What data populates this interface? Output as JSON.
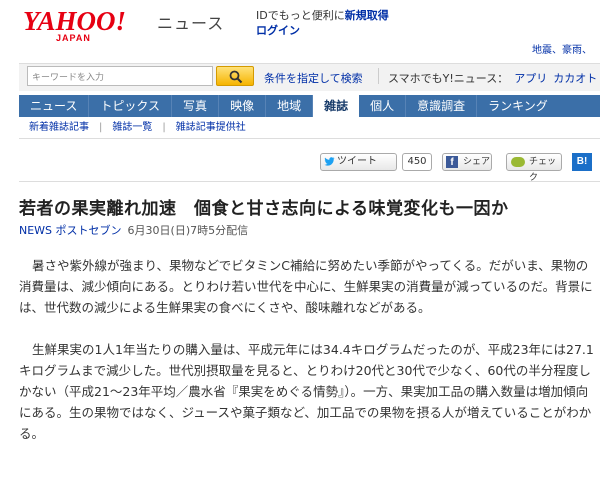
{
  "header": {
    "logo_text": "YAHOO!",
    "logo_sub": "JAPAN",
    "service_name": "ニュース",
    "promo_text": "IDでもっと便利に",
    "promo_link": "新規取得",
    "login_link": "ログイン",
    "region_links": "地震、豪雨、"
  },
  "search": {
    "placeholder": "キーワードを入力",
    "advanced_link": "条件を指定して検索",
    "smartphone_label": "スマホでもY!ニュース：",
    "app_link": "アプリ",
    "catalog_link": "カカオト"
  },
  "nav": {
    "items": [
      "ニュース",
      "トピックス",
      "写真",
      "映像",
      "地域",
      "雑誌",
      "個人",
      "意識調査",
      "ランキング"
    ],
    "active_index": 5
  },
  "subnav": {
    "items": [
      "新着雑誌記事",
      "雑誌一覧",
      "雑誌記事提供社"
    ]
  },
  "share": {
    "tweet_label": "ツイート",
    "tweet_count": "450",
    "facebook_label": "シェア",
    "check_label": "チェック",
    "hatena_label": "B!"
  },
  "article": {
    "title": "若者の果実離れ加速　個食と甘さ志向による味覚変化も一因か",
    "source_tag": "NEWS ポストセブン",
    "date": "6月30日(日)7時5分配信",
    "paragraphs": [
      "暑さや紫外線が強まり、果物などでビタミンC補給に努めたい季節がやってくる。だがいま、果物の消費量は、減少傾向にある。とりわけ若い世代を中心に、生鮮果実の消費量が減っているのだ。背景には、世代数の減少による生鮮果実の食べにくさや、酸味離れなどがある。",
      "生鮮果実の1人1年当たりの購入量は、平成元年には34.4キログラムだったのが、平成23年には27.1キログラムまで減少した。世代別摂取量を見ると、とりわけ20代と30代で少なく、60代の半分程度しかない（平成21～23年平均／農水省『果実をめぐる情勢』）。一方、果実加工品の購入数量は増加傾向にある。生の果物ではなく、ジュースや菓子類など、加工品での果物を摂る人が増えていることがわかる。"
    ]
  },
  "colors": {
    "brand_red": "#e60012",
    "nav_blue": "#3b6fa8",
    "link_blue": "#002fa7"
  }
}
